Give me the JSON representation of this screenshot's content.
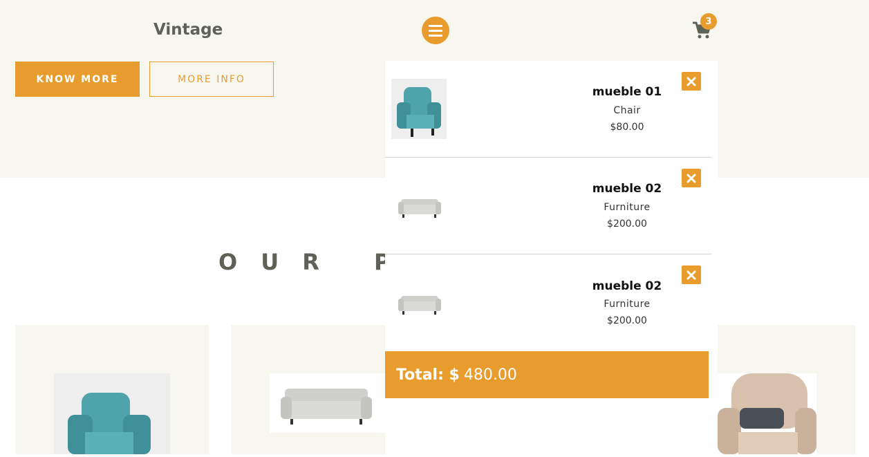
{
  "hero": {
    "title": "Vintage",
    "primary_button": "KNOW MORE",
    "secondary_button": "MORE INFO"
  },
  "header": {
    "menu_icon": "hamburger-menu-icon",
    "cart_icon": "shopping-cart-icon",
    "cart_count": "3"
  },
  "section": {
    "heading": "OUR P"
  },
  "cart": {
    "items": [
      {
        "name": "mueble 01",
        "category": "Chair",
        "price": "$80.00",
        "thumb": "armchair-image"
      },
      {
        "name": "mueble 02",
        "category": "Furniture",
        "price": "$200.00",
        "thumb": "sofa-image"
      },
      {
        "name": "mueble 02",
        "category": "Furniture",
        "price": "$200.00",
        "thumb": "sofa-image"
      }
    ],
    "total_label": "Total: $",
    "total_value": "480.00",
    "remove_icon": "close-icon"
  },
  "colors": {
    "accent": "#e99c2e",
    "hero_bg": "#f7f7f0",
    "text_dark": "#5d6156"
  }
}
